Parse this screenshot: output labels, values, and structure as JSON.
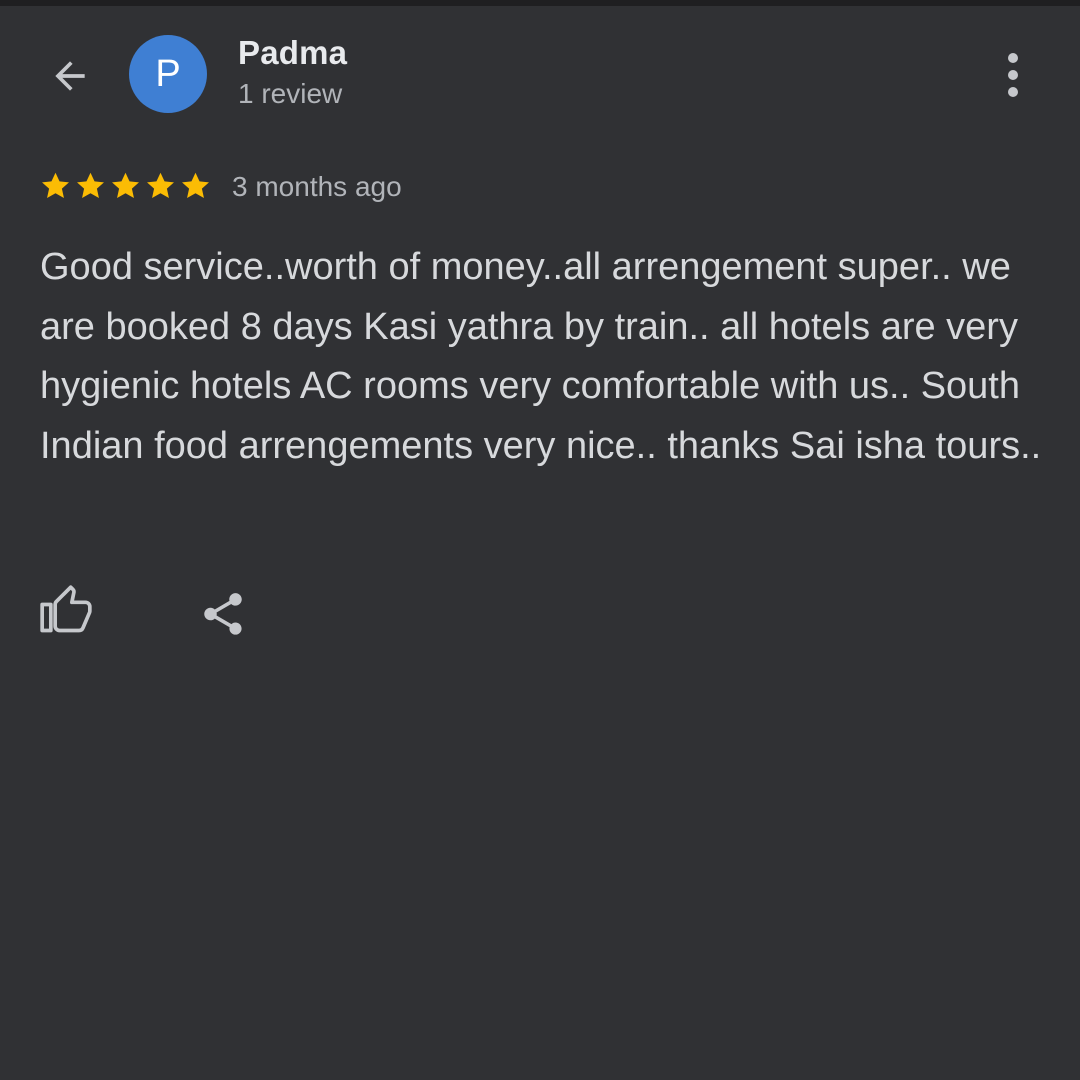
{
  "header": {
    "back_icon": "arrow-left-icon",
    "avatar_initial": "P",
    "avatar_color": "#3f7fd3",
    "reviewer_name": "Padma",
    "review_count": "1 review",
    "more_icon": "more-vert-icon"
  },
  "review": {
    "rating": 5,
    "rating_max": 5,
    "star_color": "#fbbc04",
    "time": "3 months ago",
    "text": "Good service..worth of money..all arrengement super.. we are booked 8 days Kasi yathra by train.. all hotels are very hygienic hotels AC rooms very comfortable with us.. South Indian food arrengements very nice.. thanks Sai isha tours.."
  },
  "actions": {
    "like_icon": "thumbs-up-icon",
    "share_icon": "share-icon"
  },
  "colors": {
    "background": "#303134",
    "text_primary": "#e8eaed",
    "text_secondary": "#b1b4b9"
  }
}
